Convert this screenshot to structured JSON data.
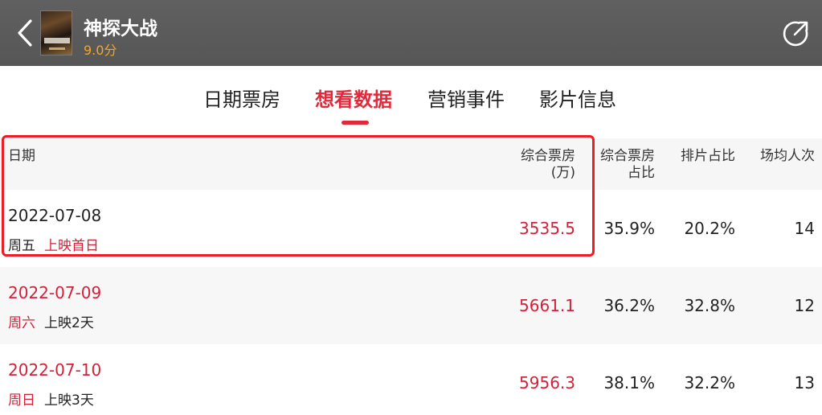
{
  "header": {
    "title": "神探大战",
    "score": "9.0分"
  },
  "tabs": [
    {
      "label": "日期票房"
    },
    {
      "label": "想看数据"
    },
    {
      "label": "营销事件"
    },
    {
      "label": "影片信息"
    }
  ],
  "table": {
    "headers": {
      "date": "日期",
      "box_line1": "综合票房",
      "box_line2": "(万)",
      "share_line1": "综合票房",
      "share_line2": "占比",
      "schedule": "排片占比",
      "avg": "场均人次"
    },
    "rows": [
      {
        "date": "2022-07-08",
        "weekday": "周五",
        "status": "上映首日",
        "box": "3535.5",
        "share": "35.9%",
        "schedule": "20.2%",
        "avg": "14"
      },
      {
        "date": "2022-07-09",
        "weekday": "周六",
        "status": "上映2天",
        "box": "5661.1",
        "share": "36.2%",
        "schedule": "32.8%",
        "avg": "12"
      },
      {
        "date": "2022-07-10",
        "weekday": "周日",
        "status": "上映3天",
        "box": "5956.3",
        "share": "38.1%",
        "schedule": "32.2%",
        "avg": "13"
      }
    ]
  },
  "colors": {
    "accent": "#e02a3b",
    "header_bg": "#5c5c5c",
    "score": "#f5a623",
    "highlight_border": "#ee1c25"
  },
  "icons": {
    "back": "chevron-left-icon",
    "share": "share-icon"
  }
}
